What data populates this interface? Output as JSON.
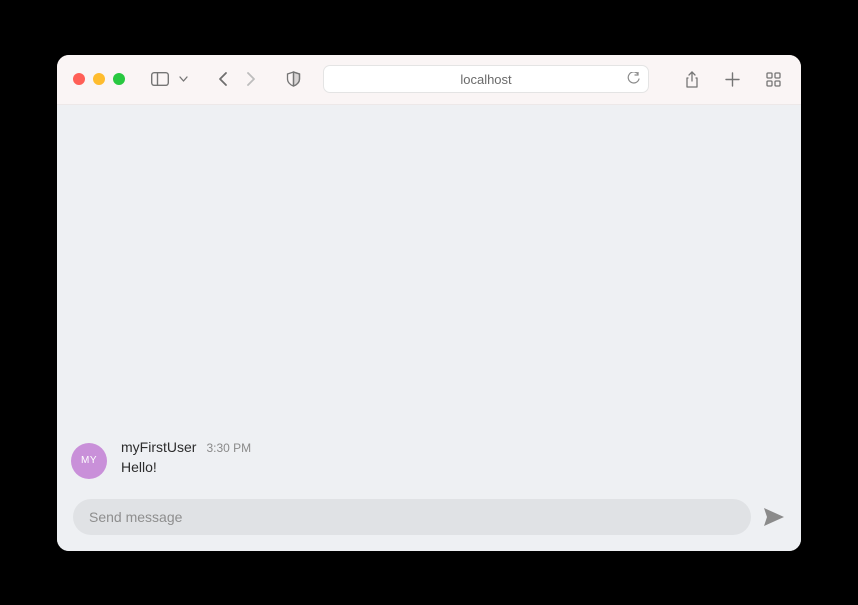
{
  "browser": {
    "address": "localhost"
  },
  "chat": {
    "messages": [
      {
        "avatar_initials": "MY",
        "username": "myFirstUser",
        "timestamp": "3:30 PM",
        "text": "Hello!"
      }
    ],
    "composer": {
      "placeholder": "Send message"
    }
  }
}
